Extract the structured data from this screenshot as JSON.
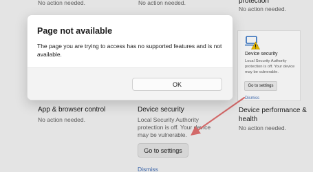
{
  "background": {
    "top_left_status": "No action needed.",
    "top_middle_status": "No action needed.",
    "top_right_label": "protection",
    "top_right_status": "No action needed.",
    "app_browser": {
      "title": "App & browser control",
      "status": "No action needed."
    },
    "device_security": {
      "title": "Device security",
      "description": "Local Security Authority protection is off. Your device may be vulnerable.",
      "button_label": "Go to settings",
      "dismiss_label": "Dismiss"
    },
    "device_performance": {
      "title": "Device performance & health",
      "status": "No action needed."
    }
  },
  "side_card": {
    "icon": "laptop-warning-icon",
    "title": "Device security",
    "description": "Local Security Authority protection is off. Your device may be vulnerable.",
    "button_label": "Go to settings",
    "dismiss_label": "Dismiss"
  },
  "dialog": {
    "title": "Page not available",
    "message": "The page you are trying to access has no supported features and is not available.",
    "ok_label": "OK"
  },
  "colors": {
    "arrow": "#e07070",
    "link": "#3f6cb4",
    "warning": "#f2c200",
    "icon_blue": "#2d6fc4"
  }
}
